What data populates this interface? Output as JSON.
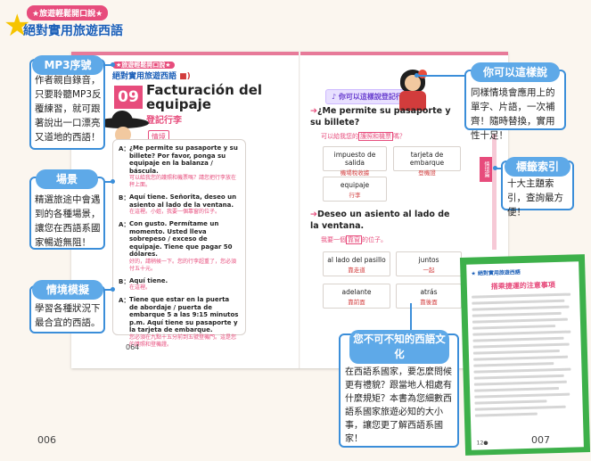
{
  "brand": {
    "top": "★旅遊輕鬆開口說★",
    "main": "絕對實用旅遊西語"
  },
  "mini_brand": {
    "top": "★旅遊輕鬆開口說★",
    "main": "絕對實用旅遊西語",
    "speaker": "■)"
  },
  "lesson": {
    "number": "09",
    "title": "Facturación del equipaje",
    "subtitle": "登記行李",
    "scene_tag": "情境"
  },
  "dialog": [
    {
      "speaker": "A：",
      "es": "¿Me permite su pasaporte y su billete? Por favor, ponga su equipaje en la balanza / báscula.",
      "zh": "可以給我您的護照和機票嗎？請您把行李放在秤上面。"
    },
    {
      "speaker": "B：",
      "es": "Aquí tiene. Señorita, deseo un asiento al lado de la ventana.",
      "zh": "在這裡。小姐，我要一個靠窗的位子。"
    },
    {
      "speaker": "A：",
      "es": "Con gusto. Permítame un momento. Usted lleva sobrepeso / exceso de equipaje. Tiene que pagar 50 dólares.",
      "zh": "好的，請稍候一下。您的行李超重了，您必須付五十元。"
    },
    {
      "speaker": "B：",
      "es": "Aquí tiene.",
      "zh": "在這裡。"
    },
    {
      "speaker": "A：",
      "es": "Tiene que estar en la puerta de abordaje / puerta de embarque 5 a las 9:15 minutos p.m. Aquí tiene su pasaporte y la tarjeta de embarque.",
      "zh": "您必須在九點十五分前到五號登機門。這是您的護照和登機證。"
    }
  ],
  "inner_page_left": "064",
  "tip_badge": {
    "icon": "♪",
    "label": "你可以這樣說登記行李"
  },
  "phrases": [
    {
      "head": "¿Me permite su pasaporte y su billete?",
      "sub_before": "可以給我您的",
      "sub_highlight": "護照和機票",
      "sub_after": "嗎？",
      "options": [
        {
          "es": "impuesto de salida",
          "zh": "機場稅收據"
        },
        {
          "es": "tarjeta de embarque",
          "zh": "登機證"
        },
        {
          "es": "equipaje",
          "zh": "行李"
        }
      ]
    },
    {
      "head": "Deseo un asiento al lado de la ventana.",
      "sub_before": "我要一個",
      "sub_highlight": "靠窗",
      "sub_after": "的位子。",
      "options": [
        {
          "es": "al lado del pasillo",
          "zh": "靠走道"
        },
        {
          "es": "juntos",
          "zh": "一起"
        },
        {
          "es": "adelante",
          "zh": "靠前面"
        },
        {
          "es": "atrás",
          "zh": "靠後面"
        }
      ]
    }
  ],
  "side_tab": "情境篇",
  "culture_book": {
    "brand": "★ 絕對實用旅遊西語",
    "title": "搭乘捷運的注意事項",
    "page": "12●"
  },
  "callouts": {
    "mp3": {
      "label": "MP3序號",
      "text": "作者親自錄音，只要聆聽MP3反覆練習，就可跟著說出一口漂亮又道地的西語！"
    },
    "scene": {
      "label": "場景",
      "text": "精選旅途中會遇到的各種場景，讓您在西語系國家暢遊無阻！"
    },
    "situation": {
      "label": "情境模擬",
      "text": "學習各種狀況下最合宜的西語。"
    },
    "say": {
      "label": "你可以這樣說",
      "text": "同樣情境會應用上的單字、片語，一次補齊！隨時替換，實用性十足！"
    },
    "index": {
      "label": "標籤索引",
      "text": "十大主題索引，查詢最方便！"
    },
    "culture": {
      "label": "您不可不知的西語文化",
      "text": "在西語系國家，要怎麼問候更有禮貌？跟當地人相處有什麼規矩？本書為您細數西語系國家旅遊必知的大小事，讓您更了解西語系國家！"
    }
  },
  "folios": {
    "left": "006",
    "right": "007"
  },
  "colors": {
    "accent_pink": "#e74c7c",
    "callout_blue": "#3b8ed9",
    "culture_green": "#3db04a"
  }
}
